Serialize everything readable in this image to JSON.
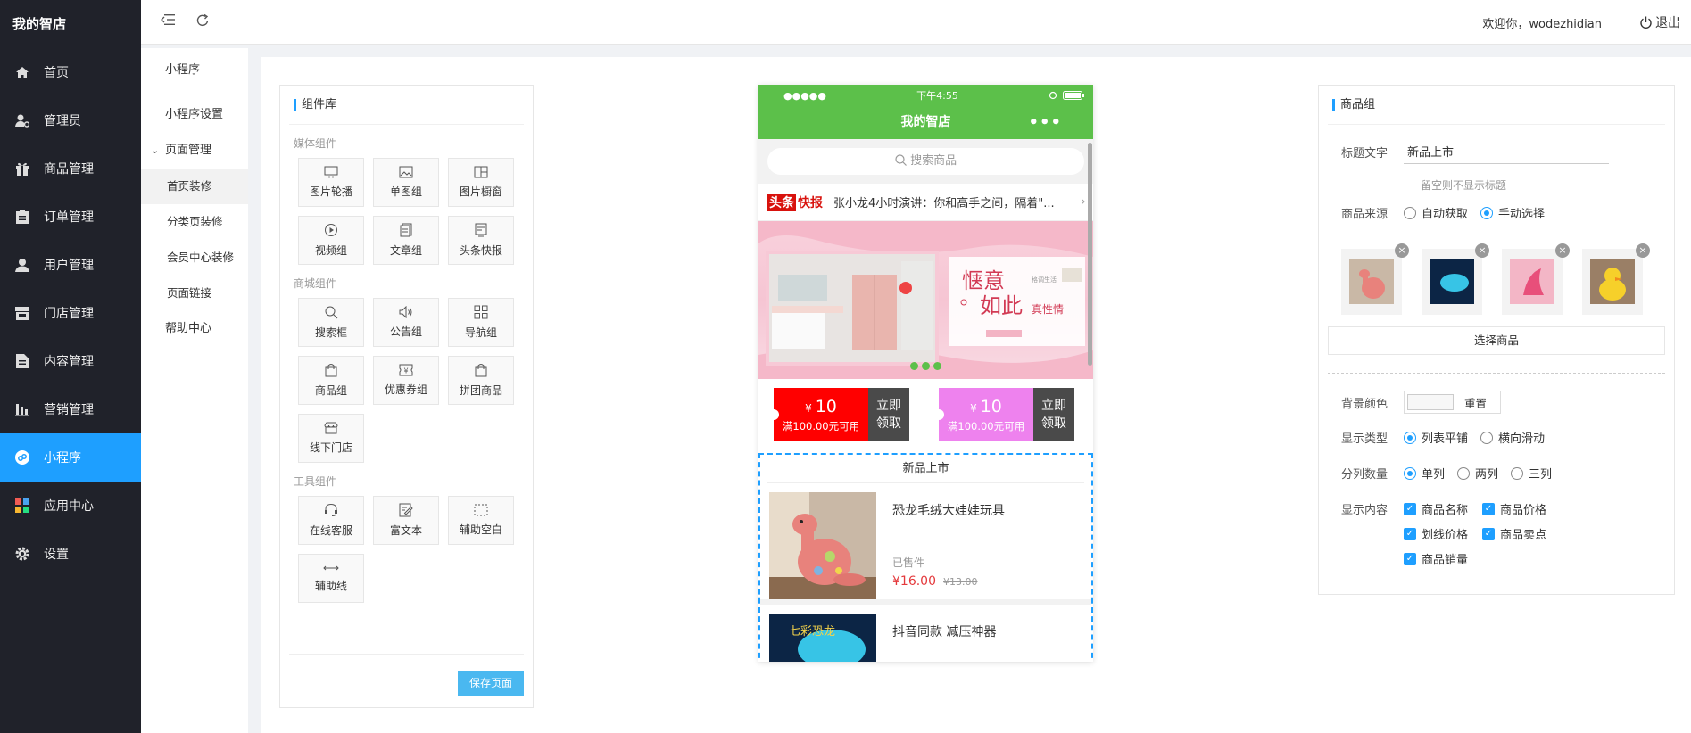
{
  "brand": "我的智店",
  "sidebar": {
    "items": [
      {
        "label": "首页",
        "icon": "home-icon"
      },
      {
        "label": "管理员",
        "icon": "admin-icon"
      },
      {
        "label": "商品管理",
        "icon": "gift-icon"
      },
      {
        "label": "订单管理",
        "icon": "clipboard-icon"
      },
      {
        "label": "用户管理",
        "icon": "user-icon"
      },
      {
        "label": "门店管理",
        "icon": "store-icon"
      },
      {
        "label": "内容管理",
        "icon": "document-icon"
      },
      {
        "label": "营销管理",
        "icon": "marketing-icon"
      },
      {
        "label": "小程序",
        "icon": "miniprogram-icon"
      },
      {
        "label": "应用中心",
        "icon": "apps-icon"
      },
      {
        "label": "设置",
        "icon": "gear-icon"
      }
    ],
    "active_index": 8,
    "accent_color": "#1e9fff"
  },
  "subnav": {
    "title": "小程序",
    "items": [
      "小程序设置",
      "页面管理",
      "首页装修",
      "分类页装修",
      "会员中心装修",
      "页面链接",
      "帮助中心"
    ]
  },
  "header": {
    "welcome": "欢迎你，wodezhidian",
    "logout": "退出"
  },
  "components": {
    "title": "组件库",
    "groups": [
      {
        "title": "媒体组件",
        "items": [
          "图片轮播",
          "单图组",
          "图片橱窗",
          "视频组",
          "文章组",
          "头条快报"
        ]
      },
      {
        "title": "商城组件",
        "items": [
          "搜索框",
          "公告组",
          "导航组",
          "商品组",
          "优惠券组",
          "拼团商品",
          "线下门店"
        ]
      },
      {
        "title": "工具组件",
        "items": [
          "在线客服",
          "富文本",
          "辅助空白",
          "辅助线"
        ]
      }
    ],
    "save_label": "保存页面"
  },
  "phone": {
    "status_signal": "●●●●●",
    "status_time": "下午4:55",
    "title": "我的智店",
    "more": "•••",
    "search_placeholder": "搜索商品",
    "news_logo_a": "头条",
    "news_logo_b": "快报",
    "news_text": "张小龙4小时演讲：你和高手之间，隔着\"...",
    "banner_text_1": "惬意",
    "banner_text_2": "如此",
    "banner_text_3": "真性情",
    "banner_brand": "格调生活",
    "coupons": [
      {
        "currency": "¥",
        "amount": "10",
        "condition": "满100.00元可用",
        "action_1": "立即",
        "action_2": "领取",
        "color": "#ff0000"
      },
      {
        "currency": "¥",
        "amount": "10",
        "condition": "满100.00元可用",
        "action_1": "立即",
        "action_2": "领取",
        "color": "#ee82ee"
      }
    ],
    "goods_title": "新品上市",
    "goods": [
      {
        "name": "恐龙毛绒大娃娃玩具",
        "sold": "已售件",
        "price": "¥16.00",
        "original_price": "¥13.00"
      },
      {
        "name": "抖音同款 减压神器",
        "img_text": "七彩恐龙"
      }
    ]
  },
  "settings": {
    "title": "商品组",
    "title_label": "标题文字",
    "title_value": "新品上市",
    "title_hint": "留空则不显示标题",
    "source_label": "商品来源",
    "source_options": [
      "自动获取",
      "手动选择"
    ],
    "source_selected": 1,
    "select_goods": "选择商品",
    "bg_label": "背景颜色",
    "bg_reset": "重置",
    "display_label": "显示类型",
    "display_options": [
      "列表平铺",
      "横向滑动"
    ],
    "display_selected": 0,
    "columns_label": "分列数量",
    "columns_options": [
      "单列",
      "两列",
      "三列"
    ],
    "columns_selected": 0,
    "content_label": "显示内容",
    "content_options": [
      "商品名称",
      "商品价格",
      "划线价格",
      "商品卖点",
      "商品销量"
    ]
  }
}
